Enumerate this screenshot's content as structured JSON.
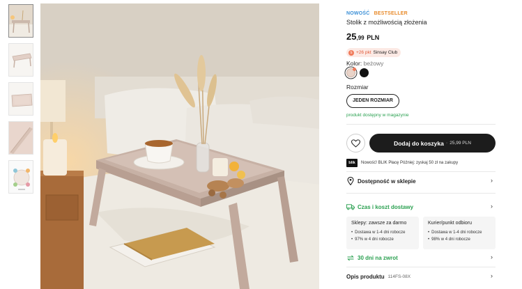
{
  "product": {
    "badge_new": "NOWOŚĆ",
    "badge_bestseller": "BESTSELLER",
    "title": "Stolik z możliwością złożenia",
    "price_int": "25",
    "price_dec": ",99",
    "price_currency": "PLN",
    "points_text": "+26 pkt",
    "points_club": "Sinsay Club",
    "color_label": "Kolor:",
    "color_value": "beżowy",
    "size_label": "Rozmiar",
    "size_option": "JEDEN ROZMIAR",
    "availability": "produkt dostępny w magazynie"
  },
  "cart": {
    "label": "Dodaj do koszyka",
    "separator": "·",
    "price": "25,99 PLN"
  },
  "blik": {
    "logo": "blik",
    "text": "Nowość! BLIK Płacę Później: zyskaj 50 zł na zakupy"
  },
  "sections": {
    "store_availability": "Dostępność w sklepie",
    "delivery_time": "Czas i koszt dostawy",
    "returns": "30 dni na zwrot",
    "product_description": "Opis produktu",
    "product_code": "114FS-08X"
  },
  "delivery": {
    "store": {
      "title": "Sklepy: zawsze za darmo",
      "line1": "Dostawa w 1-4 dni robocze",
      "line2": "97% w 4 dni robocze"
    },
    "courier": {
      "title": "Kurier/punkt odbioru",
      "line1": "Dostawa w 1-4 dni robocze",
      "line2": "98% w 4 dni robocze"
    }
  },
  "swatches": [
    {
      "name": "beige",
      "color": "#e9d3c8"
    },
    {
      "name": "black",
      "color": "#111111"
    }
  ],
  "icons": {
    "favorite": "heart-icon",
    "store": "location-pin-icon",
    "delivery": "truck-icon",
    "returns": "return-arrows-icon",
    "chevron": "chevron-right-icon"
  },
  "colors": {
    "accent_green": "#2aa050",
    "badge_new": "#3a8fd6",
    "badge_bestseller": "#e88a2a",
    "cart_bg": "#1c1c1c"
  }
}
